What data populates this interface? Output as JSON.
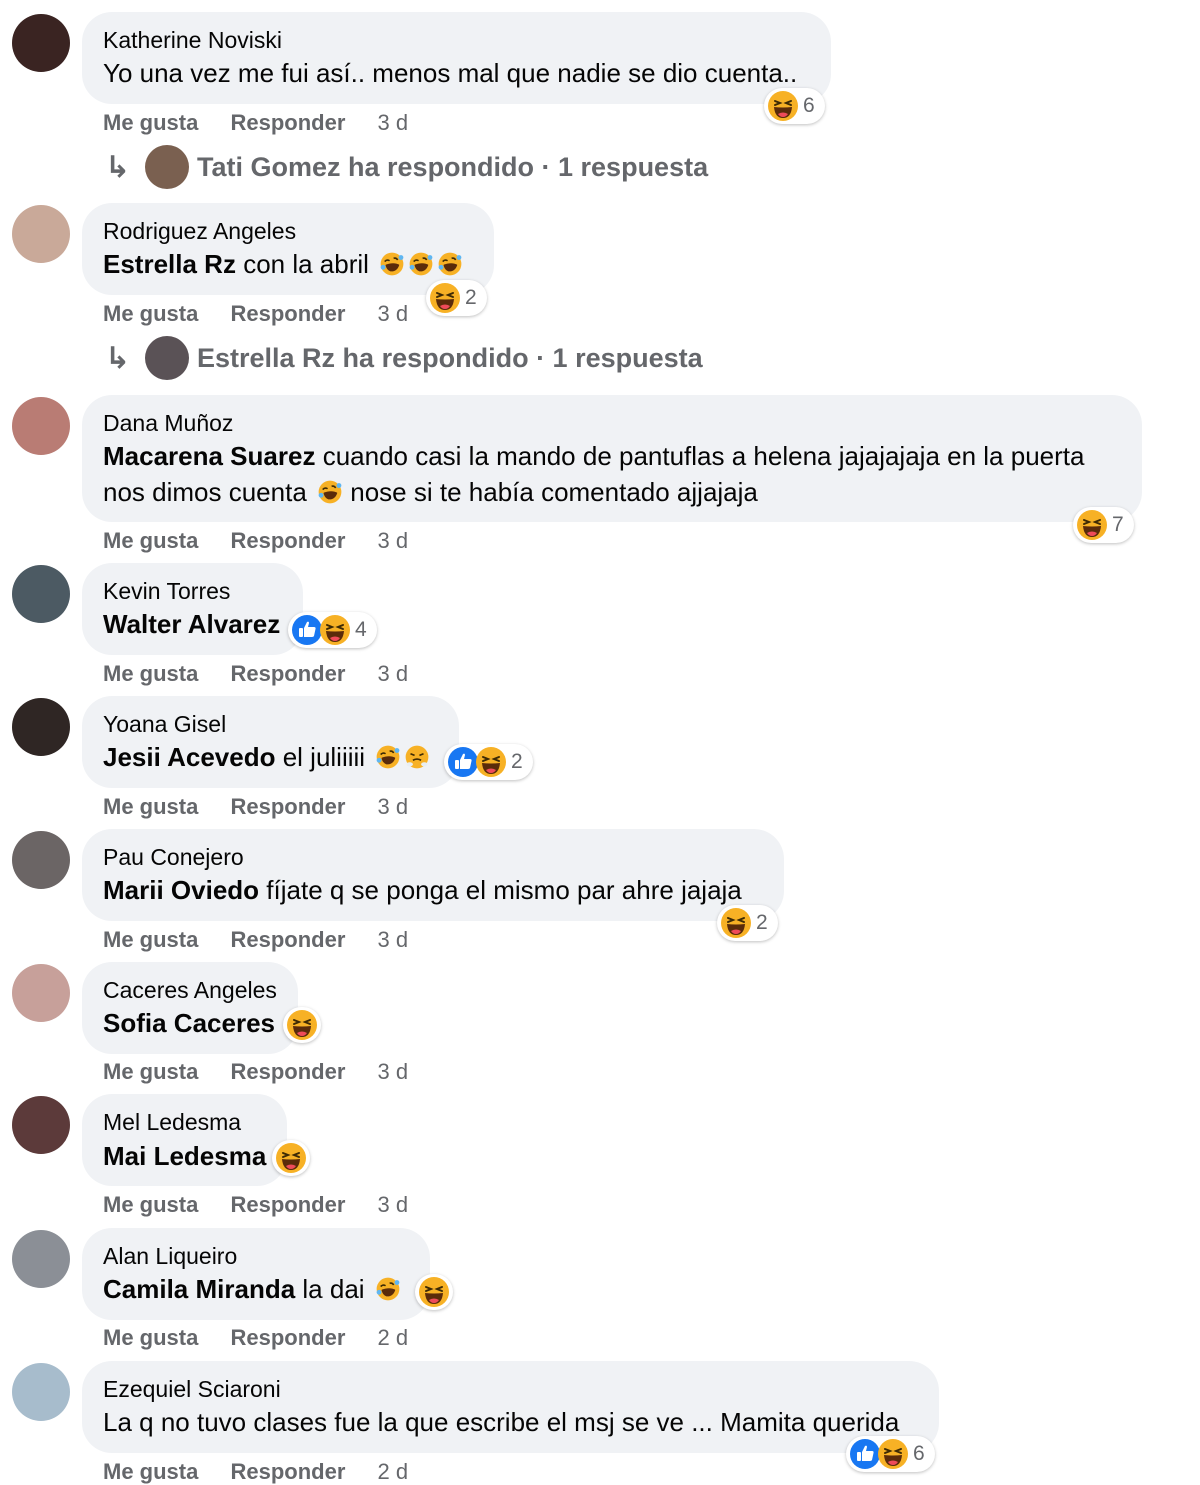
{
  "actions": {
    "like": "Me gusta",
    "reply": "Responder"
  },
  "comments": [
    {
      "author": "Katherine Noviski",
      "text": "Yo una vez me fui así.. menos mal que nadie se dio cuenta..",
      "time": "3 d",
      "reaction_count": "6",
      "reply_summary": {
        "name": "Tati Gomez",
        "label": "Tati Gomez ha respondido · 1 respuesta"
      }
    },
    {
      "author": "Rodriguez Angeles",
      "mention": "Estrella Rz",
      "text": "con la abril",
      "time": "3 d",
      "reaction_count": "2",
      "reply_summary": {
        "name": "Estrella Rz",
        "label": "Estrella Rz ha respondido · 1 respuesta"
      }
    },
    {
      "author": "Dana Muñoz",
      "mention": "Macarena Suarez",
      "text": "cuando casi la mando de pantuflas a helena jajajajaja en la puerta",
      "text2": "nos dimos cuenta",
      "text3": "nose si te había comentado ajjajaja",
      "time": "3 d",
      "reaction_count": "7"
    },
    {
      "author": "Kevin Torres",
      "mention": "Walter Alvarez",
      "time": "3 d",
      "reaction_count": "4"
    },
    {
      "author": "Yoana Gisel",
      "mention": "Jesii Acevedo",
      "text": "el juliiiii",
      "time": "3 d",
      "reaction_count": "2"
    },
    {
      "author": "Pau Conejero",
      "mention": "Marii Oviedo",
      "text": "fíjate q se ponga el mismo par ahre jajaja",
      "time": "3 d",
      "reaction_count": "2"
    },
    {
      "author": "Caceres Angeles",
      "mention": "Sofia Caceres",
      "time": "3 d"
    },
    {
      "author": "Mel Ledesma",
      "mention": "Mai Ledesma",
      "time": "3 d"
    },
    {
      "author": "Alan Liqueiro",
      "mention": "Camila Miranda",
      "text": "la dai",
      "time": "2 d"
    },
    {
      "author": "Ezequiel Sciaroni",
      "text": "La q no tuvo clases fue la que escribe el msj se ve ... Mamita querida",
      "time": "2 d",
      "reaction_count": "6"
    }
  ],
  "icons": {
    "haha": "haha-reaction-icon",
    "like": "like-reaction-icon",
    "rofl": "rolling-laughing-emoji",
    "steam": "huffing-emoji",
    "reply_arrow": "reply-arrow-icon"
  },
  "colors": {
    "bubble": "#f0f2f5",
    "meta": "#65676b",
    "like_blue": "#1877f2",
    "haha_yellow": "#f7b125"
  }
}
